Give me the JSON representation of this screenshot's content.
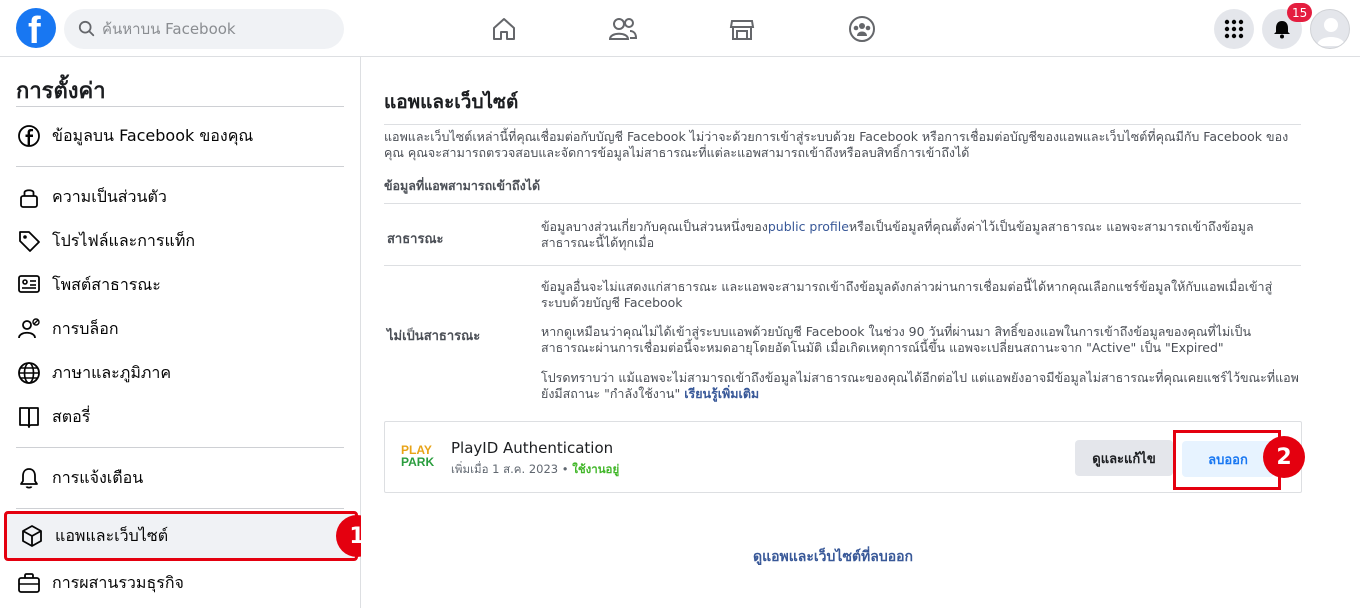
{
  "topbar": {
    "logo_letter": "f",
    "search_placeholder": "ค้นหาบน Facebook",
    "notifications_count": "15"
  },
  "sidebar": {
    "title": "การตั้งค่า",
    "items": [
      {
        "label": "ข้อมูลบน Facebook ของคุณ",
        "icon": "facebook-icon"
      },
      {
        "label": "ความเป็นส่วนตัว",
        "icon": "lock-icon"
      },
      {
        "label": "โปรไฟล์และการแท็ก",
        "icon": "tag-icon"
      },
      {
        "label": "โพสต์สาธารณะ",
        "icon": "public-posts-icon"
      },
      {
        "label": "การบล็อก",
        "icon": "block-user-icon"
      },
      {
        "label": "ภาษาและภูมิภาค",
        "icon": "globe-icon"
      },
      {
        "label": "สตอรี่",
        "icon": "book-icon"
      },
      {
        "label": "การแจ้งเตือน",
        "icon": "bell-icon"
      },
      {
        "label": "แอพและเว็บไซต์",
        "icon": "box-icon"
      },
      {
        "label": "การผสานรวมธุรกิจ",
        "icon": "briefcase-icon"
      }
    ]
  },
  "markers": {
    "one": "1",
    "two": "2"
  },
  "main": {
    "title": "แอพและเว็บไซต์",
    "description": "แอพและเว็บไซต์เหล่านี้ที่คุณเชื่อมต่อกับบัญชี Facebook ไม่ว่าจะด้วยการเข้าสู่ระบบด้วย Facebook หรือการเชื่อมต่อบัญชีของแอพและเว็บไซต์ที่คุณมีกับ Facebook ของคุณ คุณจะสามารถตรวจสอบและจัดการข้อมูลไม่สาธารณะที่แต่ละแอพสามารถเข้าถึงหรือลบสิทธิ์การเข้าถึงได้",
    "subhead": "ข้อมูลที่แอพสามารถเข้าถึงได้",
    "public_label": "สาธารณะ",
    "public_text_1": "ข้อมูลบางส่วนเกี่ยวกับคุณเป็นส่วนหนึ่งของ",
    "public_link": "public profile",
    "public_text_2": "หรือเป็นข้อมูลที่คุณตั้งค่าไว้เป็นข้อมูลสาธารณะ แอพจะสามารถเข้าถึงข้อมูลสาธารณะนี้ได้ทุกเมื่อ",
    "nonpublic_label": "ไม่เป็นสาธารณะ",
    "nonpublic_p1": "ข้อมูลอื่นจะไม่แสดงแก่สาธารณะ และแอพจะสามารถเข้าถึงข้อมูลดังกล่าวผ่านการเชื่อมต่อนี้ได้หากคุณเลือกแชร์ข้อมูลให้กับแอพเมื่อเข้าสู่ระบบด้วยบัญชี Facebook",
    "nonpublic_p2": "หากดูเหมือนว่าคุณไม่ได้เข้าสู่ระบบแอพด้วยบัญชี Facebook ในช่วง 90 วันที่ผ่านมา สิทธิ์ของแอพในการเข้าถึงข้อมูลของคุณที่ไม่เป็นสาธารณะผ่านการเชื่อมต่อนี้จะหมดอายุโดยอัตโนมัติ เมื่อเกิดเหตุการณ์นี้ขึ้น แอพจะเปลี่ยนสถานะจาก \"Active\" เป็น \"Expired\"",
    "nonpublic_p3": "โปรดทราบว่า แม้แอพจะไม่สามารถเข้าถึงข้อมูลไม่สาธารณะของคุณได้อีกต่อไป แต่แอพยังอาจมีข้อมูลไม่สาธารณะที่คุณเคยแชร์ไว้ขณะที่แอพยังมีสถานะ \"กำลังใช้งาน\"",
    "learn_more": "เรียนรู้เพิ่มเติม",
    "app": {
      "logo_line1": "PLAY",
      "logo_line2": "PARK",
      "name": "PlayID Authentication",
      "added": "เพิ่มเมื่อ 1 ส.ค. 2023",
      "separator": "•",
      "status": "ใช้งานอยู่",
      "edit_label": "ดูและแก้ไข",
      "remove_label": "ลบออก"
    },
    "removed_link": "ดูแอพและเว็บไซต์ที่ลบออก"
  },
  "colors": {
    "accent": "#1877f2",
    "annotation": "#e4000f",
    "active_status": "#42b72a"
  }
}
